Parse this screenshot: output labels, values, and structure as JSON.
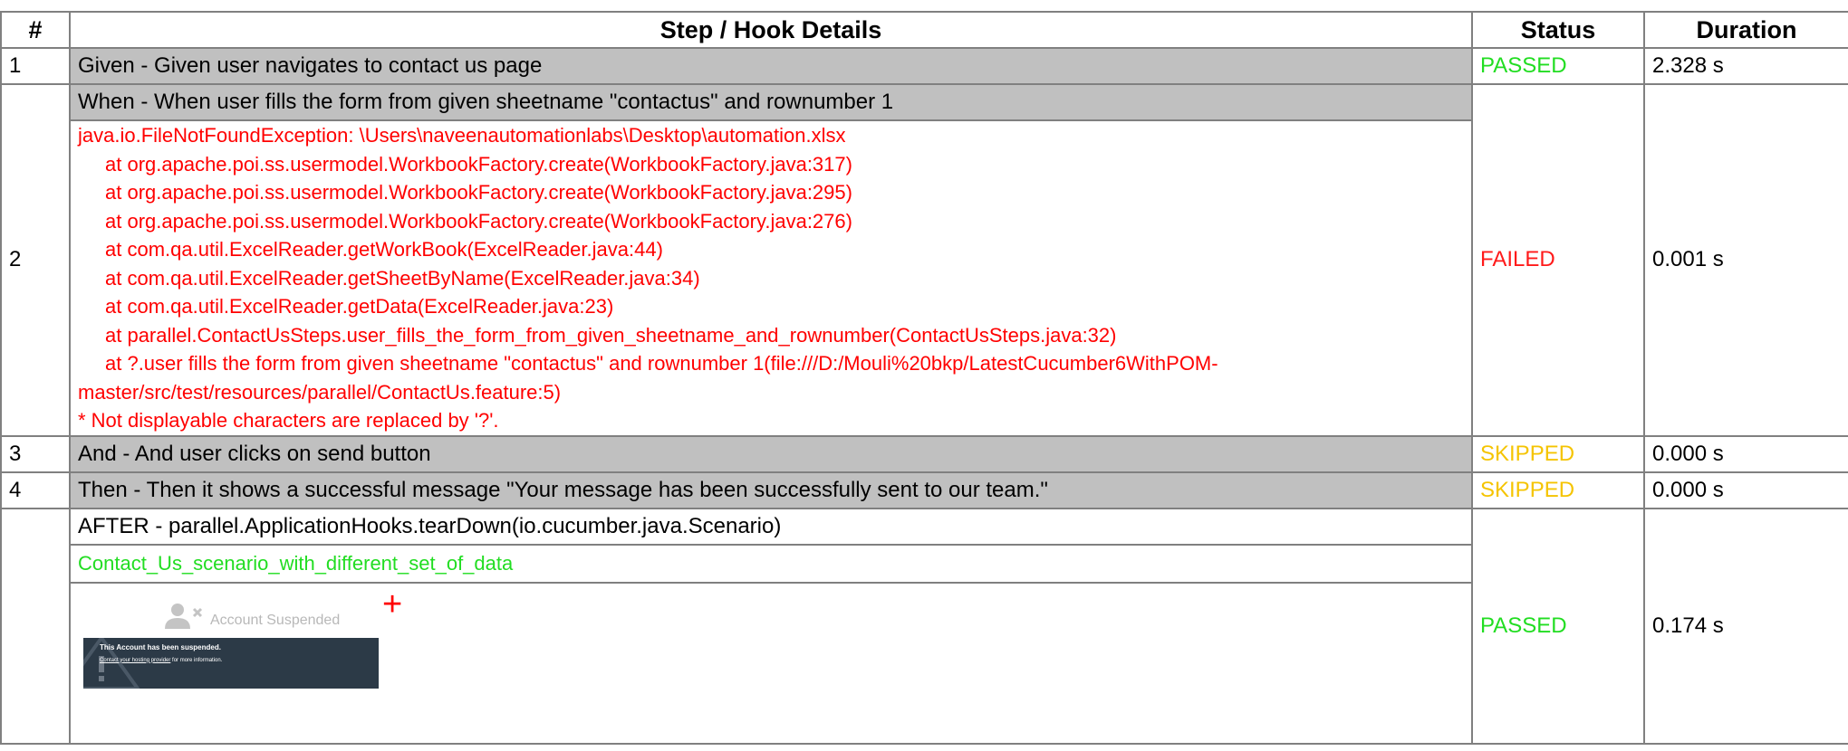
{
  "headers": {
    "num": "#",
    "details": "Step / Hook Details",
    "status": "Status",
    "duration": "Duration"
  },
  "steps": [
    {
      "num": "1",
      "details": "Given - Given user navigates to contact us page",
      "status": "PASSED",
      "duration": "2.328 s"
    },
    {
      "num": "2",
      "details": "When - When user fills the form from given sheetname \"contactus\" and rownumber 1",
      "status": "FAILED",
      "duration": "0.001 s"
    },
    {
      "num": "3",
      "details": "And - And user clicks on send button",
      "status": "SKIPPED",
      "duration": "0.000 s"
    },
    {
      "num": "4",
      "details": "Then - Then it shows a successful message \"Your message has been successfully sent to our team.\"",
      "status": "SKIPPED",
      "duration": "0.000 s"
    }
  ],
  "error": {
    "exception": "java.io.FileNotFoundException: \\Users\\naveenautomationlabs\\Desktop\\automation.xlsx",
    "trace": [
      "at org.apache.poi.ss.usermodel.WorkbookFactory.create(WorkbookFactory.java:317)",
      "at org.apache.poi.ss.usermodel.WorkbookFactory.create(WorkbookFactory.java:295)",
      "at org.apache.poi.ss.usermodel.WorkbookFactory.create(WorkbookFactory.java:276)",
      "at com.qa.util.ExcelReader.getWorkBook(ExcelReader.java:44)",
      "at com.qa.util.ExcelReader.getSheetByName(ExcelReader.java:34)",
      "at com.qa.util.ExcelReader.getData(ExcelReader.java:23)",
      "at parallel.ContactUsSteps.user_fills_the_form_from_given_sheetname_and_rownumber(ContactUsSteps.java:32)"
    ],
    "trace_wrapped": "at ?.user fills the form from given sheetname \"contactus\" and rownumber 1(file:///D:/Mouli%20bkp/LatestCucumber6WithPOM-master/src/test/resources/parallel/ContactUs.feature:5)",
    "note": "* Not displayable characters are replaced by '?'."
  },
  "hook": {
    "details": "AFTER - parallel.ApplicationHooks.tearDown(io.cucumber.java.Scenario)",
    "status": "PASSED",
    "duration": "0.174 s",
    "embedded_text": "Contact_Us_scenario_with_different_set_of_data",
    "screenshot": {
      "label": "Account Suspended",
      "title": "This Account has been suspended.",
      "link_text": "Contact your hosting provider",
      "link_suffix": " for more information."
    },
    "expand_symbol": "+"
  },
  "colors": {
    "passed": "#22dd22",
    "failed": "#ff1a1a",
    "skipped": "#f5c400",
    "error_text": "#ff0000",
    "step_bg": "#c0c0c0",
    "border": "#808080"
  }
}
